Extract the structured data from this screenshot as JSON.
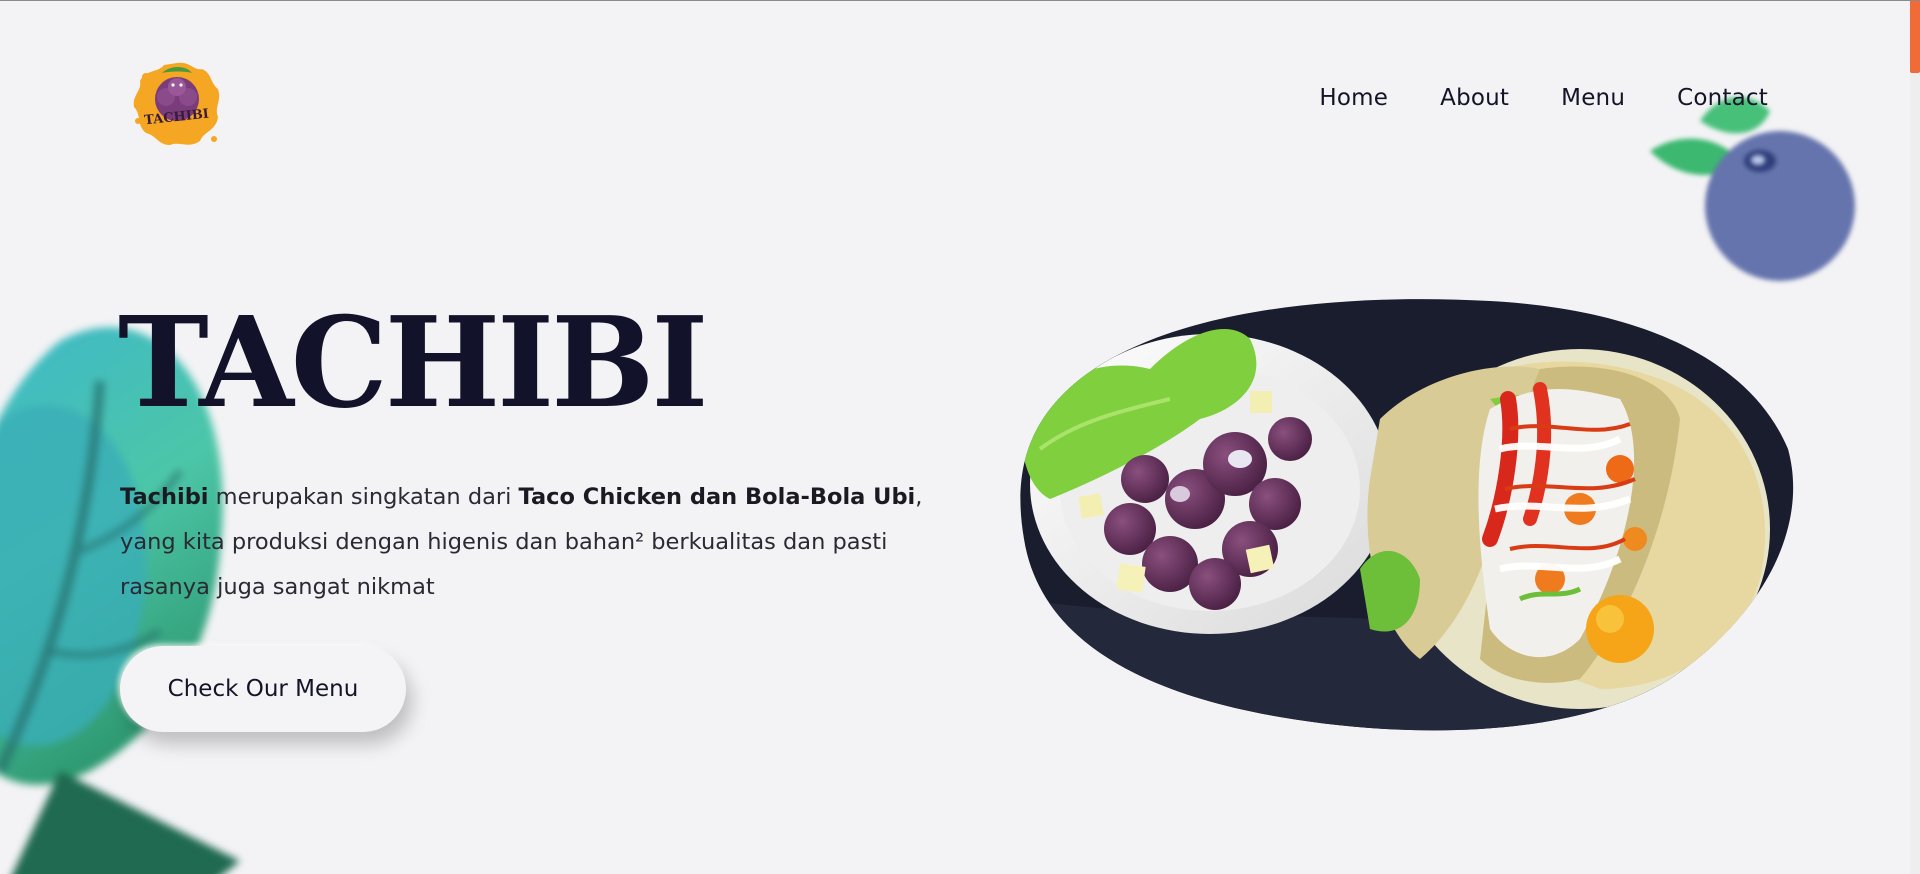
{
  "brand": {
    "logo_text": "TACHIBI"
  },
  "nav": {
    "items": [
      {
        "label": "Home"
      },
      {
        "label": "About"
      },
      {
        "label": "Menu"
      },
      {
        "label": "Contact"
      }
    ]
  },
  "hero": {
    "title": "TACHIBI",
    "desc_bold_1": "Tachibi",
    "desc_text_1": " merupakan singkatan dari ",
    "desc_bold_2": "Taco Chicken dan Bola-Bola Ubi",
    "desc_text_2": ", yang kita produksi dengan higenis dan bahan² berkualitas dan pasti rasanya juga sangat nikmat",
    "cta_label": "Check Our Menu"
  },
  "colors": {
    "background": "#f3f3f5",
    "text_dark": "#12122a",
    "accent_orange": "#f06b35",
    "ubi_purple": "#5a2a55",
    "leaf_teal": "#3ab6c8",
    "berry_blue": "#6574ad"
  },
  "icons": {
    "logo": "tachibi-logo-icon",
    "leaf": "leaf-decoration-icon",
    "berry": "blueberry-decoration-icon"
  }
}
